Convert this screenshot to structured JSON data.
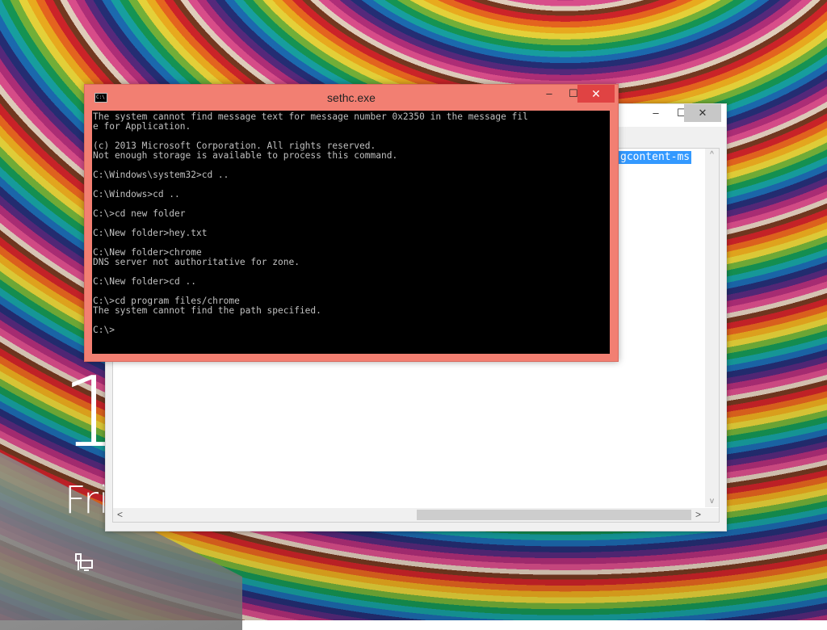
{
  "lock_screen": {
    "time_partial": "1",
    "day_partial": "Fri",
    "network_icon": "network-icon"
  },
  "background_window": {
    "controls": {
      "minimize": "–",
      "maximize": "☐",
      "close": "✕"
    },
    "selected_text": "gcontent-ms",
    "scroll": {
      "up": "^",
      "down": "v",
      "left": "<",
      "right": ">"
    }
  },
  "cmd_window": {
    "title": "sethc.exe",
    "icon_text": "C:\\",
    "controls": {
      "minimize": "–",
      "maximize": "☐",
      "close": "✕"
    },
    "lines": [
      "The system cannot find message text for message number 0x2350 in the message fil",
      "e for Application.",
      "",
      "(c) 2013 Microsoft Corporation. All rights reserved.",
      "Not enough storage is available to process this command.",
      "",
      "C:\\Windows\\system32>cd ..",
      "",
      "C:\\Windows>cd ..",
      "",
      "C:\\>cd new folder",
      "",
      "C:\\New folder>hey.txt",
      "",
      "C:\\New folder>chrome",
      "DNS server not authoritative for zone.",
      "",
      "C:\\New folder>cd ..",
      "",
      "C:\\>cd program files/chrome",
      "The system cannot find the path specified.",
      "",
      "C:\\>"
    ]
  }
}
